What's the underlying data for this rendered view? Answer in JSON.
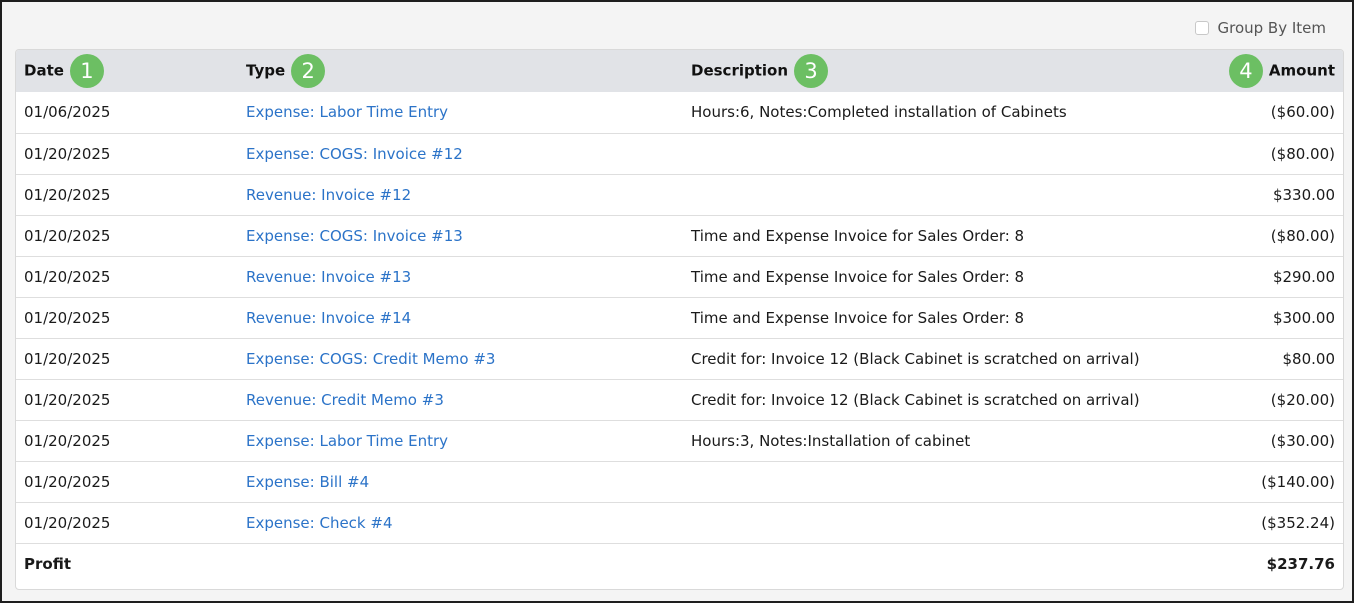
{
  "toolbar": {
    "group_by_label": "Group By Item",
    "group_by_checked": false
  },
  "columns": [
    {
      "label": "Date",
      "badge": "1"
    },
    {
      "label": "Type",
      "badge": "2"
    },
    {
      "label": "Description",
      "badge": "3"
    },
    {
      "label": "Amount",
      "badge": "4"
    }
  ],
  "rows": [
    {
      "date": "01/06/2025",
      "type": "Expense: Labor Time Entry",
      "description": "Hours:6, Notes:Completed installation of Cabinets",
      "amount": "($60.00)"
    },
    {
      "date": "01/20/2025",
      "type": "Expense: COGS: Invoice #12",
      "description": "",
      "amount": "($80.00)"
    },
    {
      "date": "01/20/2025",
      "type": "Revenue: Invoice #12",
      "description": "",
      "amount": "$330.00"
    },
    {
      "date": "01/20/2025",
      "type": "Expense: COGS: Invoice #13",
      "description": "Time and Expense Invoice for Sales Order: 8",
      "amount": "($80.00)"
    },
    {
      "date": "01/20/2025",
      "type": "Revenue: Invoice #13",
      "description": "Time and Expense Invoice for Sales Order: 8",
      "amount": "$290.00"
    },
    {
      "date": "01/20/2025",
      "type": "Revenue: Invoice #14",
      "description": "Time and Expense Invoice for Sales Order: 8",
      "amount": "$300.00"
    },
    {
      "date": "01/20/2025",
      "type": "Expense: COGS: Credit Memo #3",
      "description": "Credit for: Invoice 12 (Black Cabinet is scratched on arrival)",
      "amount": "$80.00"
    },
    {
      "date": "01/20/2025",
      "type": "Revenue: Credit Memo #3",
      "description": "Credit for: Invoice 12 (Black Cabinet is scratched on arrival)",
      "amount": "($20.00)"
    },
    {
      "date": "01/20/2025",
      "type": "Expense: Labor Time Entry",
      "description": "Hours:3, Notes:Installation of cabinet",
      "amount": "($30.00)"
    },
    {
      "date": "01/20/2025",
      "type": "Expense: Bill #4",
      "description": "",
      "amount": "($140.00)"
    },
    {
      "date": "01/20/2025",
      "type": "Expense: Check #4",
      "description": "",
      "amount": "($352.24)"
    }
  ],
  "footer": {
    "label": "Profit",
    "amount": "$237.76"
  },
  "colors": {
    "link": "#2b73c8",
    "badge": "#6cbf63",
    "header_bg": "#e1e3e7"
  }
}
